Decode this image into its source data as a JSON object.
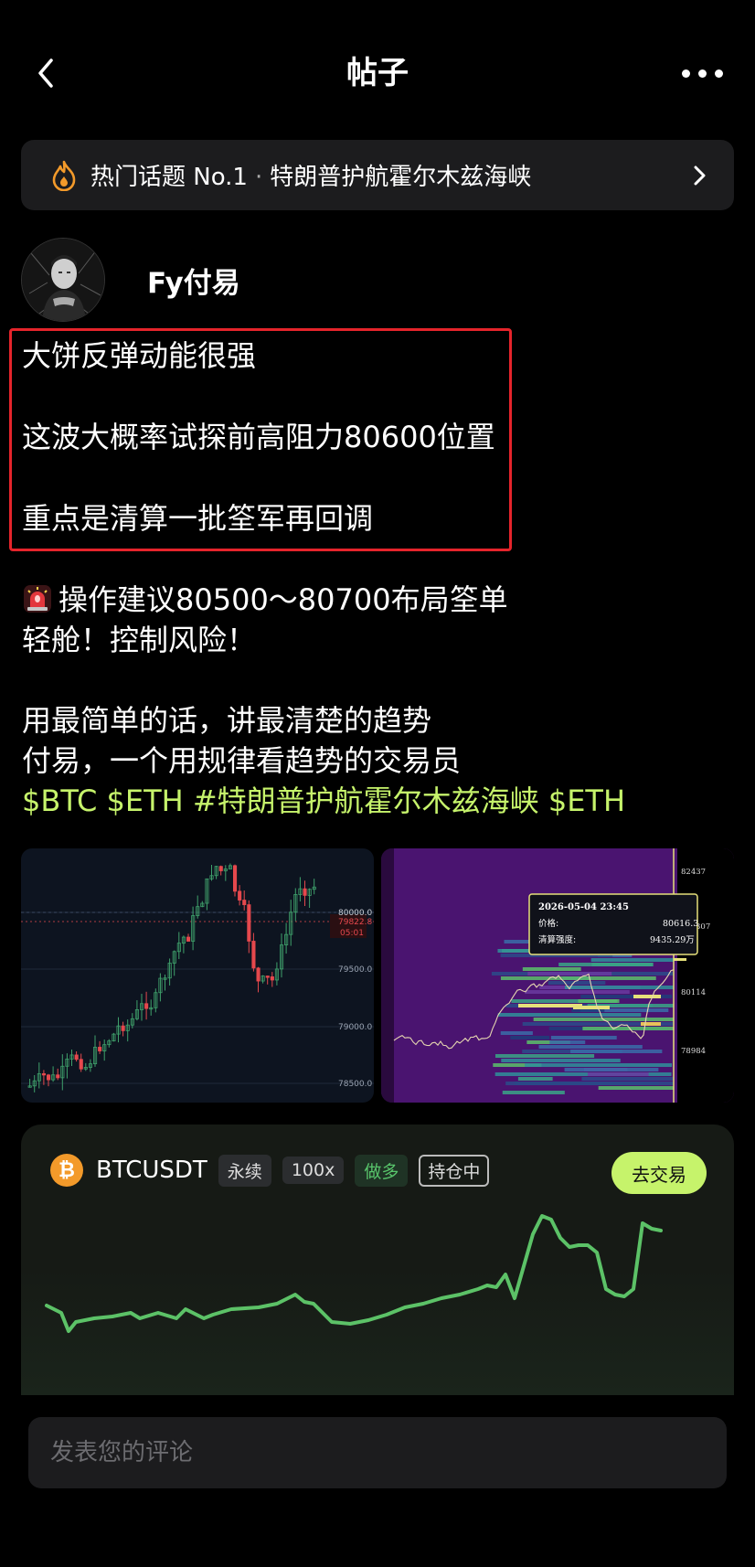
{
  "header": {
    "title": "帖子"
  },
  "topic": {
    "label": "热门话题 No.1",
    "separator": "·",
    "name": "特朗普护航霍尔木兹海峡"
  },
  "author": {
    "name": "Fy付易"
  },
  "post": {
    "line1": "大饼反弹动能很强",
    "line2": "这波大概率试探前高阻力80600位置",
    "line3": "重点是清算一批筌军再回调",
    "line4": "操作建议80500～80700布局筌单",
    "line5": "轻舱！控制风险！",
    "line6": "用最简单的话，讲最清楚的趋势",
    "line7": "付易，一个用规律看趋势的交易员",
    "tags": "$BTC $ETH #特朗普护航霍尔木兹海峡 $ETH"
  },
  "chart_left": {
    "price_labels": [
      "80000.0",
      "79500.0",
      "79000.0",
      "78500.0"
    ],
    "current_price": "79822.8",
    "countdown": "05:01"
  },
  "chart_right": {
    "price_labels": [
      "82437",
      "307",
      "80114",
      "78984"
    ],
    "tooltip": {
      "date": "2026-05-04 23:45",
      "price_label": "价格:",
      "price_value": "80616.3",
      "strength_label": "清算强度:",
      "strength_value": "9435.29万"
    }
  },
  "trade": {
    "coin_letter": "₿",
    "symbol": "BTCUSDT",
    "tags": [
      "永续",
      "100x",
      "做多",
      "持仓中"
    ],
    "button": "去交易",
    "line_color": "#5cc267"
  },
  "comment": {
    "placeholder": "发表您的评论"
  },
  "colors": {
    "accent": "#c6f36b",
    "highlight_box": "#e5242b",
    "bg": "#000000"
  }
}
